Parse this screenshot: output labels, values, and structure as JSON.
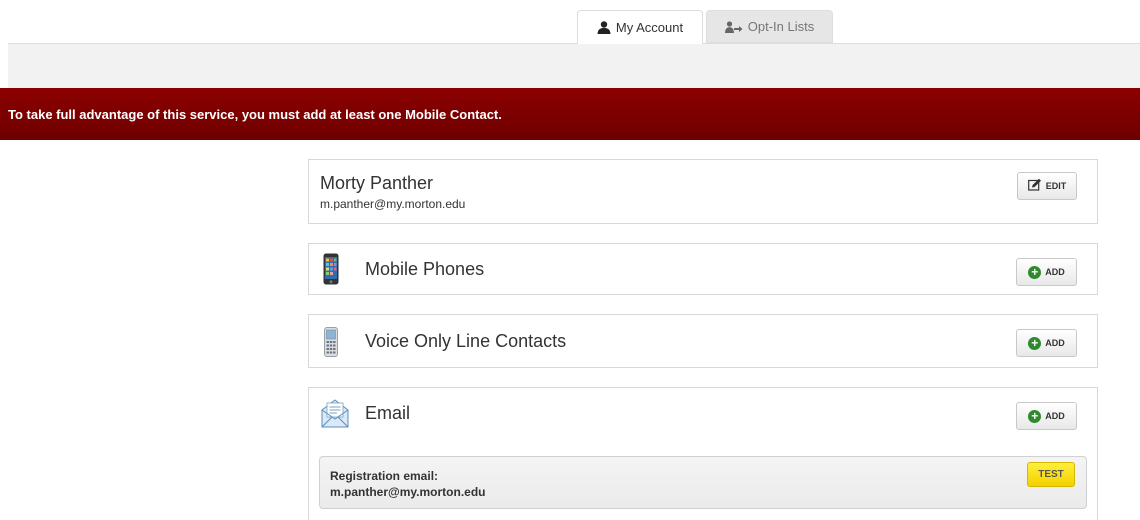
{
  "tabs": [
    {
      "label": "My Account",
      "icon": "user-icon",
      "active": true
    },
    {
      "label": "Opt-In Lists",
      "icon": "user-arrow-icon",
      "active": false
    }
  ],
  "alert": {
    "text": "To take full advantage of this service, you must add at least one Mobile Contact.",
    "color": "#8b0000"
  },
  "profile": {
    "name": "Morty Panther",
    "email": "m.panther@my.morton.edu",
    "edit_label": "EDIT"
  },
  "sections": {
    "mobile": {
      "title": "Mobile Phones",
      "icon": "smartphone-icon",
      "add_label": "ADD"
    },
    "voice": {
      "title": "Voice Only Line Contacts",
      "icon": "desk-phone-icon",
      "add_label": "ADD"
    },
    "email": {
      "title": "Email",
      "icon": "envelope-icon",
      "add_label": "ADD"
    }
  },
  "registration": {
    "label": "Registration email:",
    "email": "m.panther@my.morton.edu",
    "test_label": "TEST"
  },
  "colors": {
    "add_icon": "#2f8a2f",
    "test_button": "#ffe000"
  }
}
